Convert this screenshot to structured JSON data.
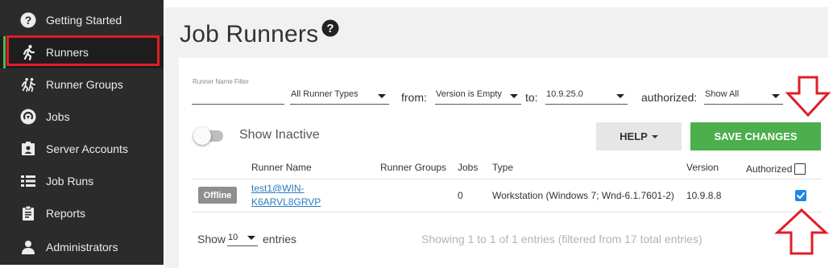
{
  "sidebar": {
    "items": [
      {
        "label": "Getting Started",
        "icon": "question-circle-icon"
      },
      {
        "label": "Runners",
        "icon": "runner-icon"
      },
      {
        "label": "Runner Groups",
        "icon": "runner-group-icon"
      },
      {
        "label": "Jobs",
        "icon": "jobs-icon"
      },
      {
        "label": "Server Accounts",
        "icon": "account-badge-icon"
      },
      {
        "label": "Job Runs",
        "icon": "list-icon"
      },
      {
        "label": "Reports",
        "icon": "clipboard-icon"
      },
      {
        "label": "Administrators",
        "icon": "user-icon"
      }
    ],
    "active_index": 1
  },
  "page": {
    "title": "Job Runners"
  },
  "filters": {
    "runner_name_label": "Runner Name Filter",
    "runner_name_value": "",
    "runner_type_value": "All Runner Types",
    "from_label": "from:",
    "from_value": "Version is Empty",
    "to_label": "to:",
    "to_value": "10.9.25.0",
    "authorized_label": "authorized:",
    "authorized_value": "Show All"
  },
  "toolbar": {
    "show_inactive_label": "Show Inactive",
    "show_inactive_on": false,
    "help_label": "HELP",
    "save_label": "SAVE CHANGES"
  },
  "table": {
    "columns": {
      "runner_name": "Runner Name",
      "runner_groups": "Runner Groups",
      "jobs": "Jobs",
      "type": "Type",
      "version": "Version",
      "authorized": "Authorized"
    },
    "header_authorized_checked": false,
    "rows": [
      {
        "status": "Offline",
        "runner_name_line1": "test1@WIN-",
        "runner_name_line2": "K6ARVL8GRVP",
        "runner_groups": "",
        "jobs": "0",
        "type": "Workstation (Windows 7; Wnd-6.1.7601-2)",
        "version": "10.9.8.8",
        "authorized": true
      }
    ]
  },
  "footer": {
    "show_label": "Show",
    "entries_value": "10",
    "entries_label": "entries",
    "info": "Showing 1 to 1 of 1 entries (filtered from 17 total entries)"
  },
  "colors": {
    "sidebar_bg": "#2b2b2b",
    "active_indicator": "#51b84f",
    "highlight_red": "#e01e28",
    "save_green": "#4cae4c",
    "checkbox_blue": "#1e88e5",
    "offline_badge": "#8f8f8f"
  }
}
